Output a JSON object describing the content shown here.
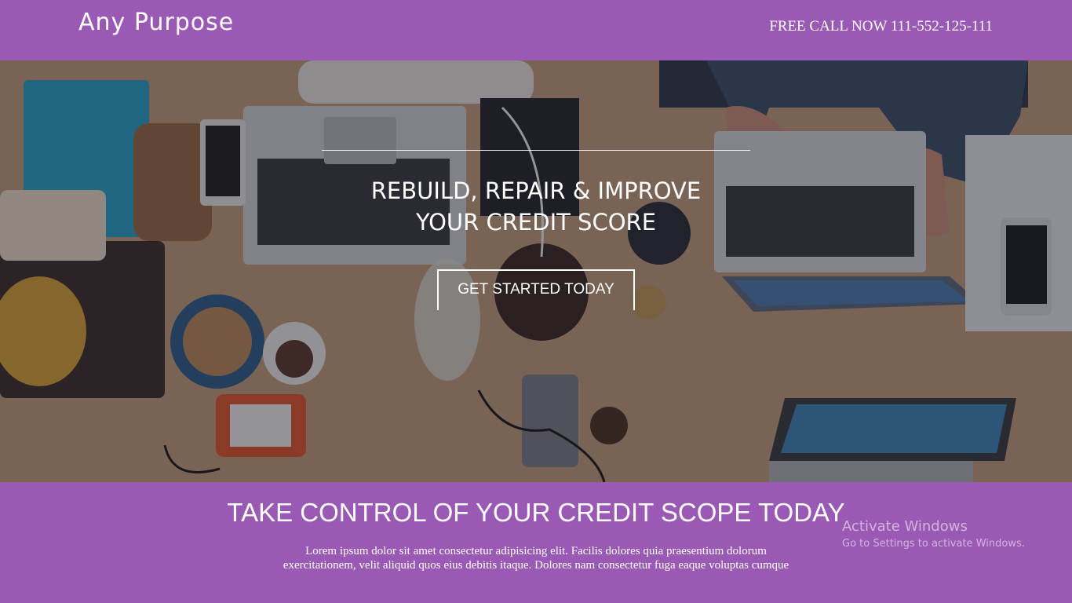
{
  "header": {
    "brand": "Any Purpose",
    "call_text": "FREE CALL NOW 111-552-125-111"
  },
  "hero": {
    "title_line1": "REBUILD, REPAIR & IMPROVE",
    "title_line2": "YOUR CREDIT SCORE",
    "cta_label": "GET STARTED TODAY"
  },
  "section": {
    "title": "TAKE CONTROL OF YOUR CREDIT SCOPE TODAY",
    "text_line1": "Lorem ipsum dolor sit amet consectetur adipisicing elit. Facilis dolores quia praesentium dolorum",
    "text_line2": "exercitationem, velit aliquid quos eius debitis itaque. Dolores nam consectetur fuga eaque voluptas cumque"
  },
  "watermark": {
    "title": "Activate Windows",
    "subtitle": "Go to Settings to activate Windows."
  },
  "colors": {
    "brand_purple": "#9b59b6",
    "text_white": "#ffffff"
  }
}
